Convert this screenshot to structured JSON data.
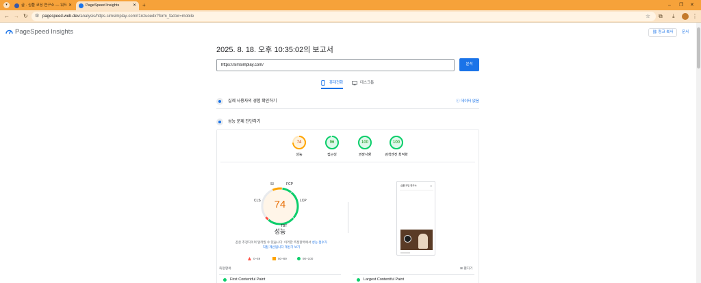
{
  "browser": {
    "tabs": [
      {
        "label": "글 · 심플 코딩 연구소 — 워드"
      },
      {
        "label": "PageSpeed Insights"
      }
    ],
    "new_tab": "+",
    "url_host": "pagespeed.web.dev",
    "url_path": "/analysis/https-simsimplay-com/r1nzuoedx?form_factor=mobile"
  },
  "header": {
    "title": "PageSpeed Insights",
    "copy_link": "링크 복사",
    "docs": "문서"
  },
  "report": {
    "title": "2025. 8. 18. 오후 10:35:02의 보고서",
    "url_value": "https://simsimplay.com/",
    "analyze": "분석"
  },
  "device_tabs": [
    {
      "label": "휴대전화",
      "active": true
    },
    {
      "label": "데스크톱",
      "active": false
    }
  ],
  "sections": {
    "field": {
      "label": "실제 사용자의 경험 확인하기",
      "right": "데이터 없음"
    },
    "diagnose": {
      "label": "성능 문제 진단하기"
    }
  },
  "categories": [
    {
      "label": "성능",
      "score": 74,
      "color": "#ffa400"
    },
    {
      "label": "접근성",
      "score": 96,
      "color": "#0cce6b"
    },
    {
      "label": "권장사항",
      "score": 100,
      "color": "#0cce6b"
    },
    {
      "label": "검색엔진 최적화",
      "score": 100,
      "color": "#0cce6b"
    }
  ],
  "performance": {
    "score": "74",
    "label": "성능",
    "metric_labels": {
      "si": "SI",
      "fcp": "FCP",
      "lcp": "LCP",
      "tbt": "TBT",
      "cls": "CLS"
    },
    "desc_plain": "값은 추정치이며 달라질 수 있습니다. 이러한 측정항목에서",
    "desc_link1": "성능 점수가",
    "desc_link2": "직접 계산됩니다",
    "desc_link3": "계산기 보기"
  },
  "legend": [
    {
      "label": "0–49",
      "color": "#ff4e42"
    },
    {
      "label": "50–89",
      "color": "#ffa400"
    },
    {
      "label": "90–100",
      "color": "#0cce6b"
    }
  ],
  "phone_preview": {
    "title": "심플 코딩 연구소"
  },
  "metrics": {
    "header": "측정항목",
    "expand": "펼치기",
    "items": [
      {
        "label": "First Contentful Paint",
        "color": "#0cce6b"
      },
      {
        "label": "Largest Contentful Paint",
        "color": "#0cce6b"
      }
    ]
  }
}
